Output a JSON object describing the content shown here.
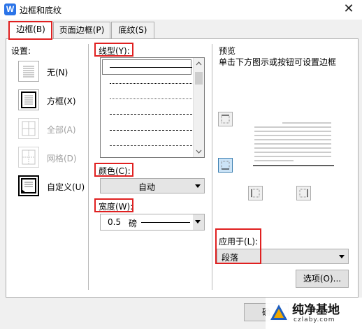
{
  "window": {
    "title": "边框和底纹",
    "app_icon": "W",
    "close_glyph": "✕"
  },
  "tabs": [
    {
      "label": "边框(B)",
      "active": true
    },
    {
      "label": "页面边框(P)",
      "active": false
    },
    {
      "label": "底纹(S)",
      "active": false
    }
  ],
  "settings": {
    "label": "设置:",
    "items": [
      {
        "label": "无(N)",
        "enabled": true
      },
      {
        "label": "方框(X)",
        "enabled": true
      },
      {
        "label": "全部(A)",
        "enabled": false
      },
      {
        "label": "网格(D)",
        "enabled": false
      },
      {
        "label": "自定义(U)",
        "enabled": true,
        "selected": true
      }
    ]
  },
  "line_style": {
    "label": "线型(Y):",
    "options": [
      "solid",
      "dotted",
      "dotted-fine",
      "dashed",
      "dash-dot",
      "dash-dot-dot",
      "dashed-small"
    ],
    "selected_index": 0
  },
  "color": {
    "label": "颜色(C):",
    "value": "自动"
  },
  "width": {
    "label": "宽度(W):",
    "value": "0.5",
    "unit": "磅"
  },
  "preview": {
    "label": "预览",
    "hint": "单击下方图示或按钮可设置边框"
  },
  "apply_to": {
    "label": "应用于(L):",
    "value": "段落"
  },
  "buttons": {
    "options": "选项(O)...",
    "ok": "确"
  },
  "watermark": {
    "text": "纯净基地",
    "sub": "czlaby.com"
  },
  "colors": {
    "highlight": "#e02020",
    "app_icon": "#2b74e8",
    "selected_bg": "#cce4f7"
  }
}
